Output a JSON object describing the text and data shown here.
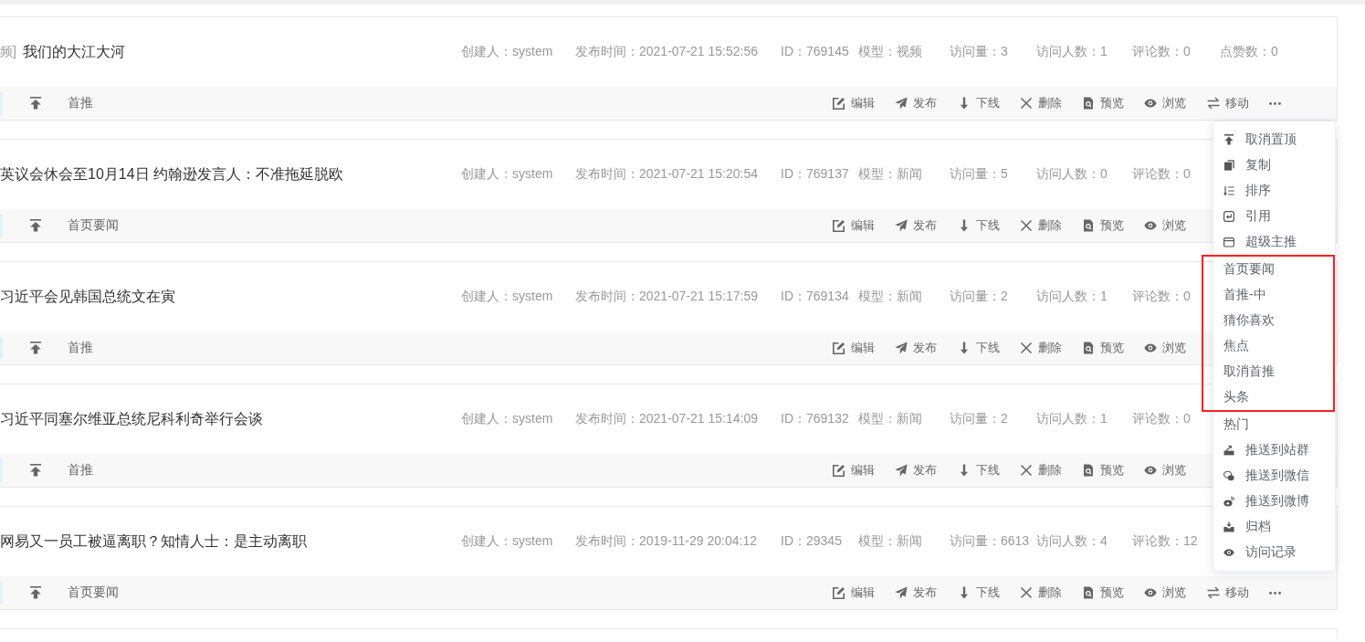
{
  "articles": [
    {
      "type_tag": "频]",
      "title": "我们的大江大河",
      "meta": {
        "creator": "创建人：system",
        "published": "发布时间：2021-07-21 15:52:56",
        "id": "ID：769145",
        "model": "模型：视频",
        "views": "访问量：3",
        "visitors": "访问人数：1",
        "comments": "评论数：0",
        "likes": "点赞数：0"
      },
      "pinned": true,
      "channel": "首推",
      "actions": [
        {
          "kind": "edit",
          "label": "编辑"
        },
        {
          "kind": "publish",
          "label": "发布"
        },
        {
          "kind": "offline",
          "label": "下线"
        },
        {
          "kind": "delete",
          "label": "删除"
        },
        {
          "kind": "preview",
          "label": "预览"
        },
        {
          "kind": "view",
          "label": "浏览"
        },
        {
          "kind": "move",
          "label": "移动"
        },
        {
          "kind": "more"
        }
      ]
    },
    {
      "title": "英议会休会至10月14日 约翰逊发言人：不准拖延脱欧",
      "meta": {
        "creator": "创建人：system",
        "published": "发布时间：2021-07-21 15:20:54",
        "id": "ID：769137",
        "model": "模型：新闻",
        "views": "访问量：5",
        "visitors": "访问人数：0",
        "comments": "评论数：0"
      },
      "pinned": true,
      "channel": "首页要闻",
      "actions": [
        {
          "kind": "edit",
          "label": "编辑"
        },
        {
          "kind": "publish",
          "label": "发布"
        },
        {
          "kind": "offline",
          "label": "下线"
        },
        {
          "kind": "delete",
          "label": "删除"
        },
        {
          "kind": "preview",
          "label": "预览"
        },
        {
          "kind": "view",
          "label": "浏览"
        }
      ]
    },
    {
      "title": "习近平会见韩国总统文在寅",
      "meta": {
        "creator": "创建人：system",
        "published": "发布时间：2021-07-21 15:17:59",
        "id": "ID：769134",
        "model": "模型：新闻",
        "views": "访问量：2",
        "visitors": "访问人数：1",
        "comments": "评论数：0"
      },
      "pinned": true,
      "channel": "首推",
      "actions": [
        {
          "kind": "edit",
          "label": "编辑"
        },
        {
          "kind": "publish",
          "label": "发布"
        },
        {
          "kind": "offline",
          "label": "下线"
        },
        {
          "kind": "delete",
          "label": "删除"
        },
        {
          "kind": "preview",
          "label": "预览"
        },
        {
          "kind": "view",
          "label": "浏览"
        }
      ]
    },
    {
      "title": "习近平同塞尔维亚总统尼科利奇举行会谈",
      "meta": {
        "creator": "创建人：system",
        "published": "发布时间：2021-07-21 15:14:09",
        "id": "ID：769132",
        "model": "模型：新闻",
        "views": "访问量：2",
        "visitors": "访问人数：1",
        "comments": "评论数：0"
      },
      "pinned": true,
      "channel": "首推",
      "actions": [
        {
          "kind": "edit",
          "label": "编辑"
        },
        {
          "kind": "publish",
          "label": "发布"
        },
        {
          "kind": "offline",
          "label": "下线"
        },
        {
          "kind": "delete",
          "label": "删除"
        },
        {
          "kind": "preview",
          "label": "预览"
        },
        {
          "kind": "view",
          "label": "浏览"
        }
      ]
    },
    {
      "title": "网易又一员工被逼离职？知情人士：是主动离职",
      "meta": {
        "creator": "创建人：system",
        "published": "发布时间：2019-11-29 20:04:12",
        "id": "ID：29345",
        "model": "模型：新闻",
        "views": "访问量：6613",
        "visitors": "访问人数：4",
        "comments": "评论数：12"
      },
      "pinned": true,
      "channel": "首页要闻",
      "actions": [
        {
          "kind": "edit",
          "label": "编辑"
        },
        {
          "kind": "publish",
          "label": "发布"
        },
        {
          "kind": "offline",
          "label": "下线"
        },
        {
          "kind": "delete",
          "label": "删除"
        },
        {
          "kind": "preview",
          "label": "预览"
        },
        {
          "kind": "view",
          "label": "浏览"
        },
        {
          "kind": "move",
          "label": "移动"
        },
        {
          "kind": "more"
        }
      ]
    }
  ],
  "menu": {
    "items": [
      {
        "kind": "unpin",
        "label": "取消置顶"
      },
      {
        "kind": "copy",
        "label": "复制"
      },
      {
        "kind": "sort",
        "label": "排序"
      },
      {
        "kind": "cite",
        "label": "引用"
      },
      {
        "kind": "promote",
        "label": "超级主推",
        "children": [
          {
            "label": "首页要闻",
            "highlighted": true
          },
          {
            "label": "首推-中",
            "highlighted": true
          },
          {
            "label": "猜你喜欢",
            "highlighted": true
          },
          {
            "label": "焦点",
            "highlighted": true
          },
          {
            "label": "取消首推",
            "highlighted": true
          },
          {
            "label": "头条",
            "highlighted": true
          },
          {
            "label": "热门",
            "highlighted": false
          }
        ]
      },
      {
        "kind": "site-group",
        "label": "推送到站群"
      },
      {
        "kind": "wechat",
        "label": "推送到微信"
      },
      {
        "kind": "weibo",
        "label": "推送到微博"
      },
      {
        "kind": "archive",
        "label": "归档"
      },
      {
        "kind": "history",
        "label": "访问记录"
      }
    ]
  }
}
